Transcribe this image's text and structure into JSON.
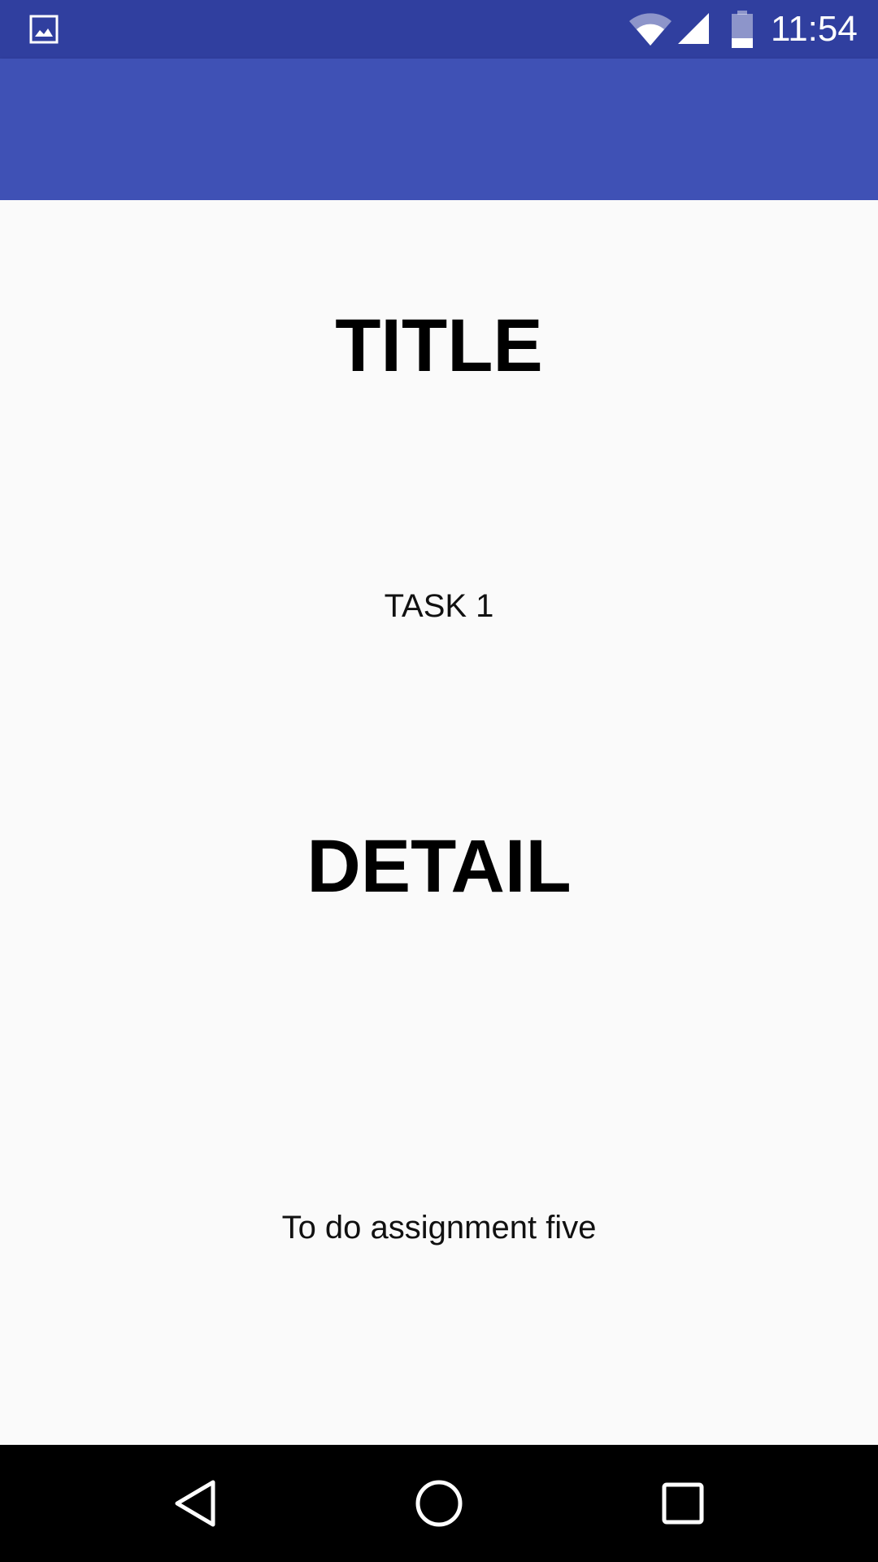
{
  "status_bar": {
    "time": "11:54",
    "icons": [
      "gallery-icon",
      "wifi-icon",
      "signal-icon",
      "battery-icon"
    ],
    "color": "#303f9f"
  },
  "app_bar": {
    "color": "#3f51b5"
  },
  "main": {
    "title_heading": "TITLE",
    "title_value": "TASK 1",
    "detail_heading": "DETAIL",
    "detail_value": "To do assignment five"
  },
  "nav_bar": {
    "buttons": [
      "back-icon",
      "home-icon",
      "recents-icon"
    ]
  }
}
